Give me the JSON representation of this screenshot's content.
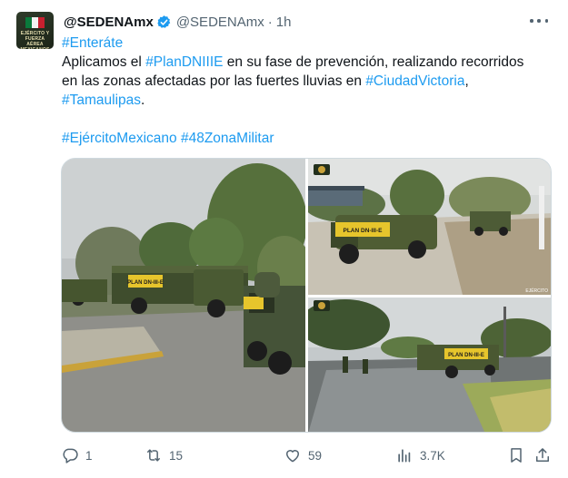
{
  "author": {
    "avatar_caption": "EJÉRCITO Y FUERZA AÉREA MEXICANOS",
    "display_name": "@SEDENAmx",
    "handle": "@SEDENAmx",
    "separator": "·",
    "time": "1h",
    "verified": true
  },
  "tweet": {
    "line1": "#Enteráte",
    "line2_pre": "Aplicamos el ",
    "tag_plan": "#PlanDNIIIE",
    "line2_post": " en su fase de prevención, realizando recorridos",
    "line3_pre": "en las zonas afectadas por las fuertes lluvias en ",
    "tag_city": "#CiudadVictoria",
    "line3_post": ",",
    "tag_state": "#Tamaulipas",
    "line4_post": ".",
    "tag_army": "#EjércitoMexicano",
    "tag_zone": "#48ZonaMilitar"
  },
  "media": {
    "photo1_sign": "PLAN DN-III-E",
    "photo2_sign": "PLAN DN-III-E",
    "photo3_sign": "PLAN DN-III-E",
    "watermark": "EJÉRCITO"
  },
  "actions": {
    "replies": "1",
    "reposts": "15",
    "likes": "59",
    "views": "3.7K"
  },
  "colors": {
    "accent": "#1d9bf0",
    "muted": "#536471",
    "text": "#0f1419",
    "border": "#cfd9de"
  },
  "icons": [
    "verified-badge-icon",
    "more-icon",
    "reply-icon",
    "repost-icon",
    "like-icon",
    "views-icon",
    "bookmark-icon",
    "share-icon"
  ]
}
